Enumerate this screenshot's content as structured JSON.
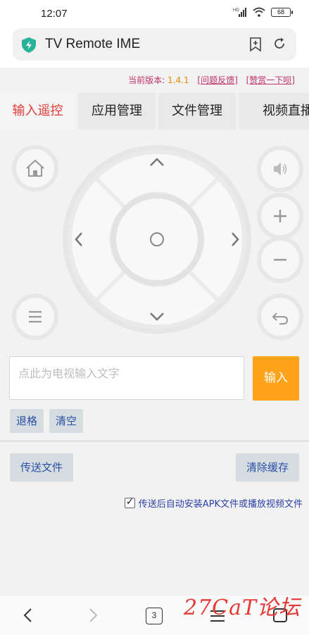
{
  "status_bar": {
    "time": "12:07",
    "battery": "68"
  },
  "browser": {
    "title": "TV Remote IME",
    "tab_count": "3"
  },
  "version": {
    "label": "当前版本:",
    "number": "1.4.1",
    "feedback": "[问题反馈]",
    "donate": "[赞赏一下呗]"
  },
  "tabs": [
    {
      "label": "输入遥控"
    },
    {
      "label": "应用管理"
    },
    {
      "label": "文件管理"
    },
    {
      "label": "视频直播"
    }
  ],
  "remote": {
    "buttons": [
      "home-icon",
      "menu-icon",
      "volume-mute-icon",
      "volume-up-icon",
      "volume-down-icon",
      "back-icon"
    ]
  },
  "text_input": {
    "placeholder": "点此为电视输入文字",
    "submit_label": "输入",
    "backspace_label": "退格",
    "clear_label": "清空"
  },
  "file_actions": {
    "send_file_label": "传送文件",
    "clear_cache_label": "清除缓存",
    "auto_install_label": "传送后自动安装APK文件或播放视频文件",
    "auto_install_checked": true
  },
  "watermark": "27CaT论坛",
  "colors": {
    "accent_red": "#e53935",
    "submit_orange": "#ffa31a",
    "link_blue": "#2a4fa8",
    "version_pink": "#c0306a"
  }
}
